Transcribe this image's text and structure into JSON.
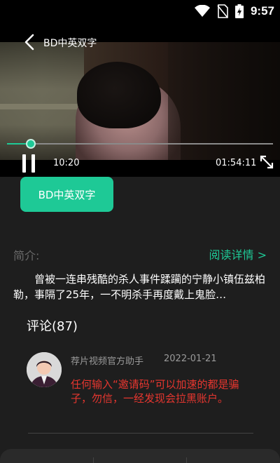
{
  "status_bar": {
    "time": "9:57",
    "icons": [
      "wifi-icon",
      "no-sim-icon",
      "battery-charging-icon"
    ]
  },
  "player": {
    "title": "BD中英双字",
    "current_time": "10:20",
    "total_time": "01:54:11",
    "progress": 0.09,
    "accent_color": "#1ec996",
    "icons": [
      "back-arrow-icon",
      "pause-icon",
      "fullscreen-icon"
    ]
  },
  "tag": {
    "label": "BD中英双字"
  },
  "intro": {
    "label": "简介:",
    "read_more": "阅读详情 >",
    "text": "曾被一连串残酷的杀人事件蹂躏的宁静小镇伍兹柏勒，事隔了25年，一不明杀手再度戴上鬼脸…"
  },
  "comments": {
    "title": "评论(87)",
    "items": [
      {
        "author": "荐片视频官方助手",
        "date": "2022-01-21",
        "body": "任何输入“邀请码”可以加速的都是骗子，勿信，一经发现会拉黑账户。"
      }
    ]
  }
}
